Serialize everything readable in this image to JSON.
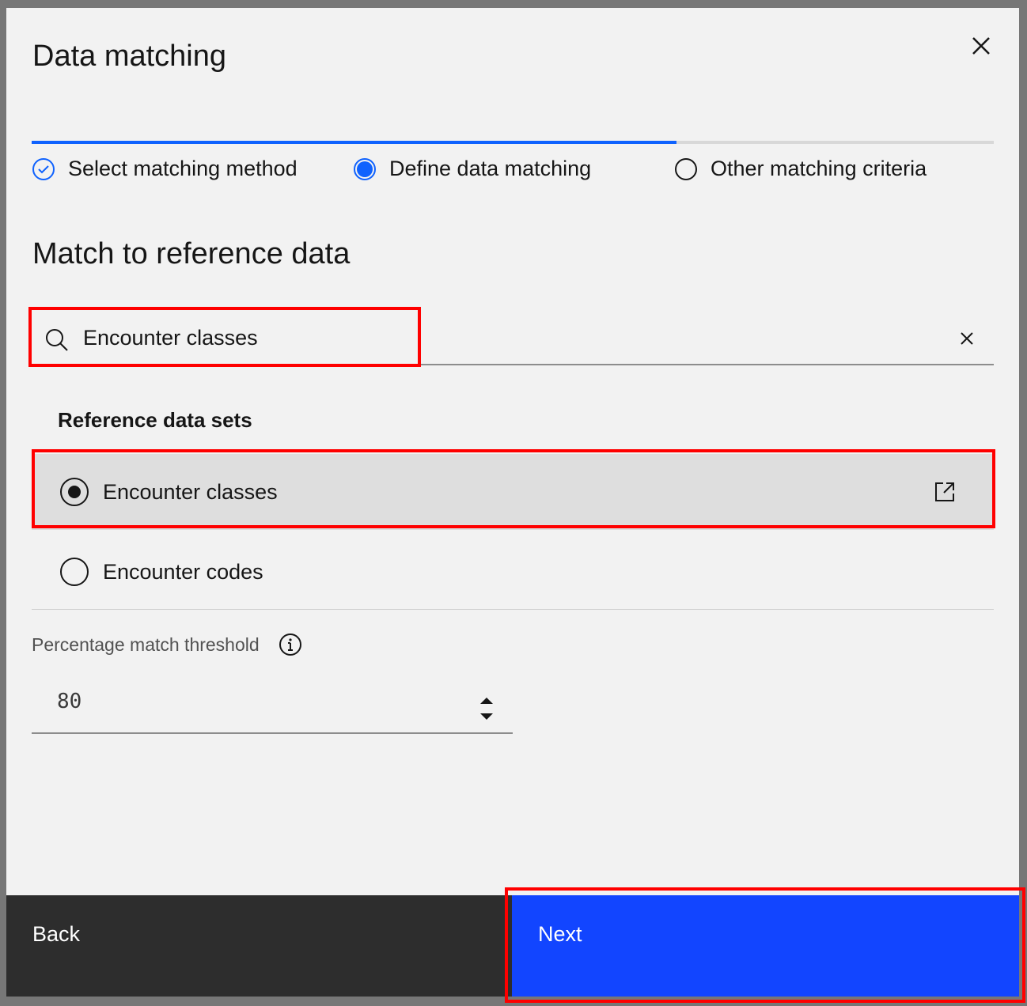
{
  "modal": {
    "title": "Data matching",
    "close_icon": "close-icon"
  },
  "progress": {
    "completed_fraction": 0.67,
    "steps": [
      {
        "label": "Select matching method",
        "state": "complete"
      },
      {
        "label": "Define data matching",
        "state": "current"
      },
      {
        "label": "Other matching criteria",
        "state": "incomplete"
      }
    ]
  },
  "section": {
    "heading": "Match to reference data"
  },
  "search": {
    "value": "Encounter classes"
  },
  "reference": {
    "heading": "Reference data sets",
    "items": [
      {
        "label": "Encounter classes",
        "selected": true
      },
      {
        "label": "Encounter codes",
        "selected": false
      }
    ]
  },
  "threshold": {
    "label": "Percentage match threshold",
    "value": "80"
  },
  "footer": {
    "back": "Back",
    "next": "Next"
  },
  "colors": {
    "accent": "#0f62fe",
    "next": "#1245ff",
    "footer_dark": "#2d2d2d",
    "highlight": "#ff0000"
  }
}
